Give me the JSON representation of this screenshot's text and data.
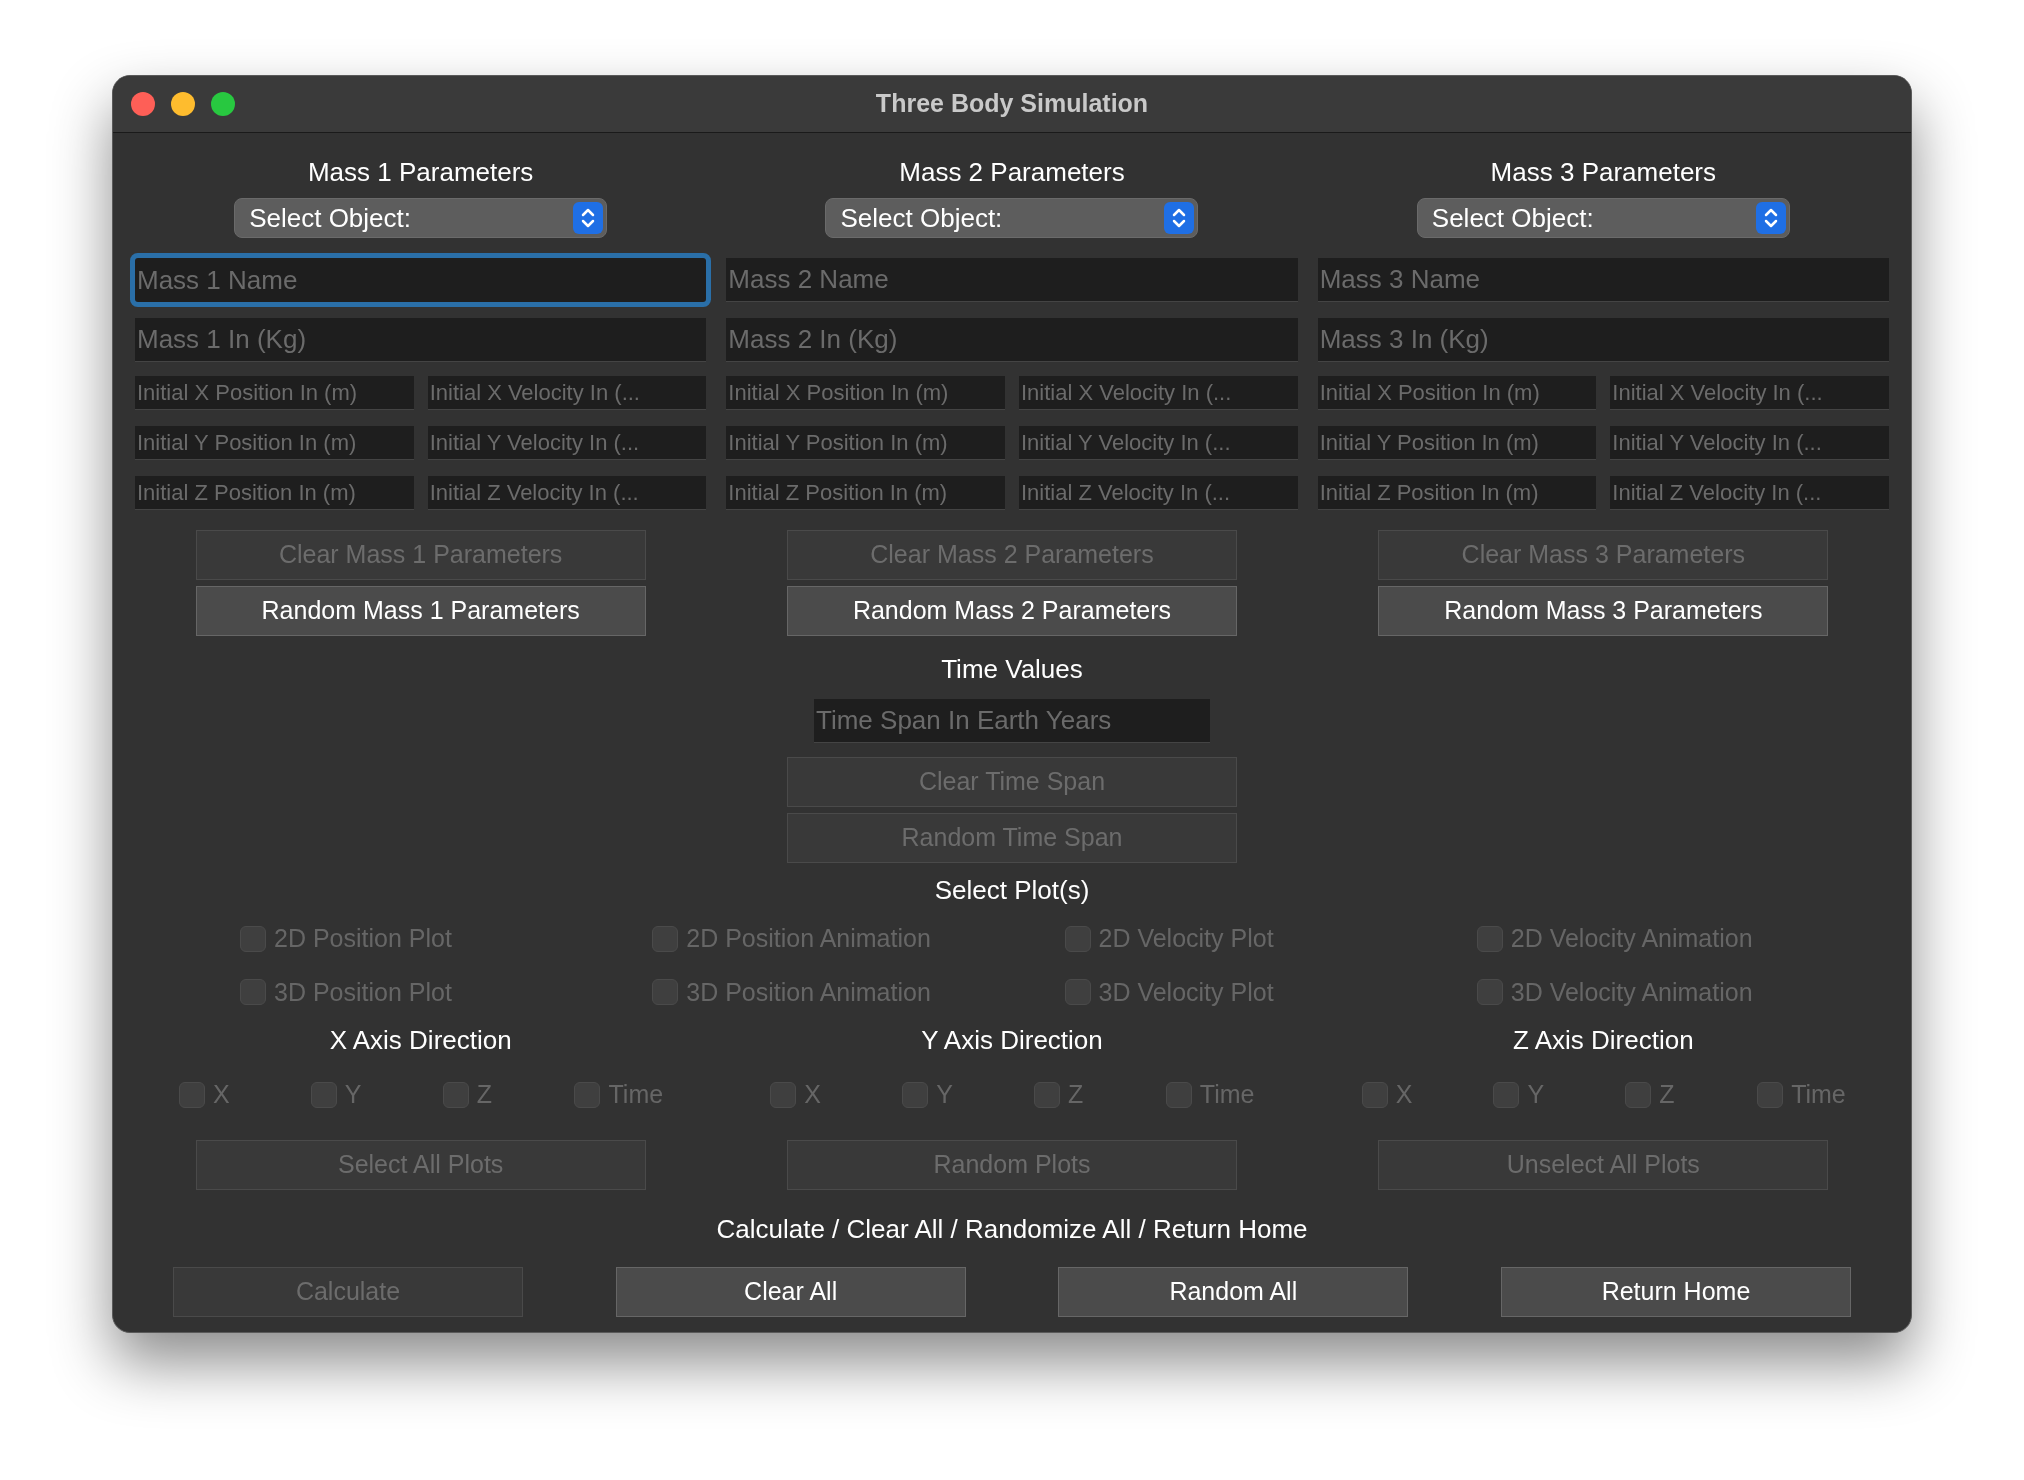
{
  "window": {
    "title": "Three Body Simulation"
  },
  "masses": [
    {
      "heading": "Mass 1 Parameters",
      "select": "Select Object:",
      "name_field": {
        "placeholder": "Mass 1 Name",
        "focused": true
      },
      "mass_field": {
        "placeholder": "Mass 1 In (Kg)"
      },
      "vector_fields": [
        {
          "placeholder": "Initial X Position In (m)"
        },
        {
          "placeholder": "Initial X Velocity In (..."
        },
        {
          "placeholder": "Initial Y Position In (m)"
        },
        {
          "placeholder": "Initial Y Velocity In (..."
        },
        {
          "placeholder": "Initial Z Position In (m)"
        },
        {
          "placeholder": "Initial Z Velocity In (..."
        }
      ],
      "buttons": [
        {
          "label": "Clear Mass 1 Parameters",
          "disabled": true
        },
        {
          "label": "Random Mass 1 Parameters",
          "disabled": false
        }
      ]
    },
    {
      "heading": "Mass 2 Parameters",
      "select": "Select Object:",
      "name_field": {
        "placeholder": "Mass 2 Name",
        "focused": false
      },
      "mass_field": {
        "placeholder": "Mass 2 In (Kg)"
      },
      "vector_fields": [
        {
          "placeholder": "Initial X Position In (m)"
        },
        {
          "placeholder": "Initial X Velocity In (..."
        },
        {
          "placeholder": "Initial Y Position In (m)"
        },
        {
          "placeholder": "Initial Y Velocity In (..."
        },
        {
          "placeholder": "Initial Z Position In (m)"
        },
        {
          "placeholder": "Initial Z Velocity In (..."
        }
      ],
      "buttons": [
        {
          "label": "Clear Mass 2 Parameters",
          "disabled": true
        },
        {
          "label": "Random Mass 2 Parameters",
          "disabled": false
        }
      ]
    },
    {
      "heading": "Mass 3 Parameters",
      "select": "Select Object:",
      "name_field": {
        "placeholder": "Mass 3 Name",
        "focused": false
      },
      "mass_field": {
        "placeholder": "Mass 3 In (Kg)"
      },
      "vector_fields": [
        {
          "placeholder": "Initial X Position In (m)"
        },
        {
          "placeholder": "Initial X Velocity In (..."
        },
        {
          "placeholder": "Initial Y Position In (m)"
        },
        {
          "placeholder": "Initial Y Velocity In (..."
        },
        {
          "placeholder": "Initial Z Position In (m)"
        },
        {
          "placeholder": "Initial Z Velocity In (..."
        }
      ],
      "buttons": [
        {
          "label": "Clear Mass 3 Parameters",
          "disabled": true
        },
        {
          "label": "Random Mass 3 Parameters",
          "disabled": false
        }
      ]
    }
  ],
  "time": {
    "heading": "Time Values",
    "field": {
      "placeholder": "Time Span In Earth Years"
    },
    "buttons": [
      {
        "label": "Clear Time Span",
        "disabled": true
      },
      {
        "label": "Random Time Span",
        "disabled": true
      }
    ]
  },
  "plots": {
    "heading": "Select Plot(s)",
    "options": [
      {
        "label": "2D Position Plot",
        "checked": false,
        "disabled": true
      },
      {
        "label": "2D Position Animation",
        "checked": false,
        "disabled": true
      },
      {
        "label": "2D Velocity Plot",
        "checked": false,
        "disabled": true
      },
      {
        "label": "2D Velocity Animation",
        "checked": false,
        "disabled": true
      },
      {
        "label": "3D Position Plot",
        "checked": false,
        "disabled": true
      },
      {
        "label": "3D Position Animation",
        "checked": false,
        "disabled": true
      },
      {
        "label": "3D Velocity Plot",
        "checked": false,
        "disabled": true
      },
      {
        "label": "3D Velocity Animation",
        "checked": false,
        "disabled": true
      }
    ]
  },
  "axes": [
    {
      "heading": "X Axis Direction",
      "options": [
        {
          "label": "X",
          "checked": false,
          "disabled": true
        },
        {
          "label": "Y",
          "checked": false,
          "disabled": true
        },
        {
          "label": "Z",
          "checked": false,
          "disabled": true
        },
        {
          "label": "Time",
          "checked": false,
          "disabled": true
        }
      ]
    },
    {
      "heading": "Y Axis Direction",
      "options": [
        {
          "label": "X",
          "checked": false,
          "disabled": true
        },
        {
          "label": "Y",
          "checked": false,
          "disabled": true
        },
        {
          "label": "Z",
          "checked": false,
          "disabled": true
        },
        {
          "label": "Time",
          "checked": false,
          "disabled": true
        }
      ]
    },
    {
      "heading": "Z Axis Direction",
      "options": [
        {
          "label": "X",
          "checked": false,
          "disabled": true
        },
        {
          "label": "Y",
          "checked": false,
          "disabled": true
        },
        {
          "label": "Z",
          "checked": false,
          "disabled": true
        },
        {
          "label": "Time",
          "checked": false,
          "disabled": true
        }
      ]
    }
  ],
  "plot_buttons": [
    {
      "label": "Select All Plots",
      "disabled": true
    },
    {
      "label": "Random Plots",
      "disabled": true
    },
    {
      "label": "Unselect All Plots",
      "disabled": true
    }
  ],
  "actions": {
    "heading": "Calculate / Clear All / Randomize All / Return Home",
    "buttons": [
      {
        "label": "Calculate",
        "disabled": true
      },
      {
        "label": "Clear All",
        "disabled": false
      },
      {
        "label": "Random All",
        "disabled": false
      },
      {
        "label": "Return Home",
        "disabled": false
      }
    ]
  }
}
